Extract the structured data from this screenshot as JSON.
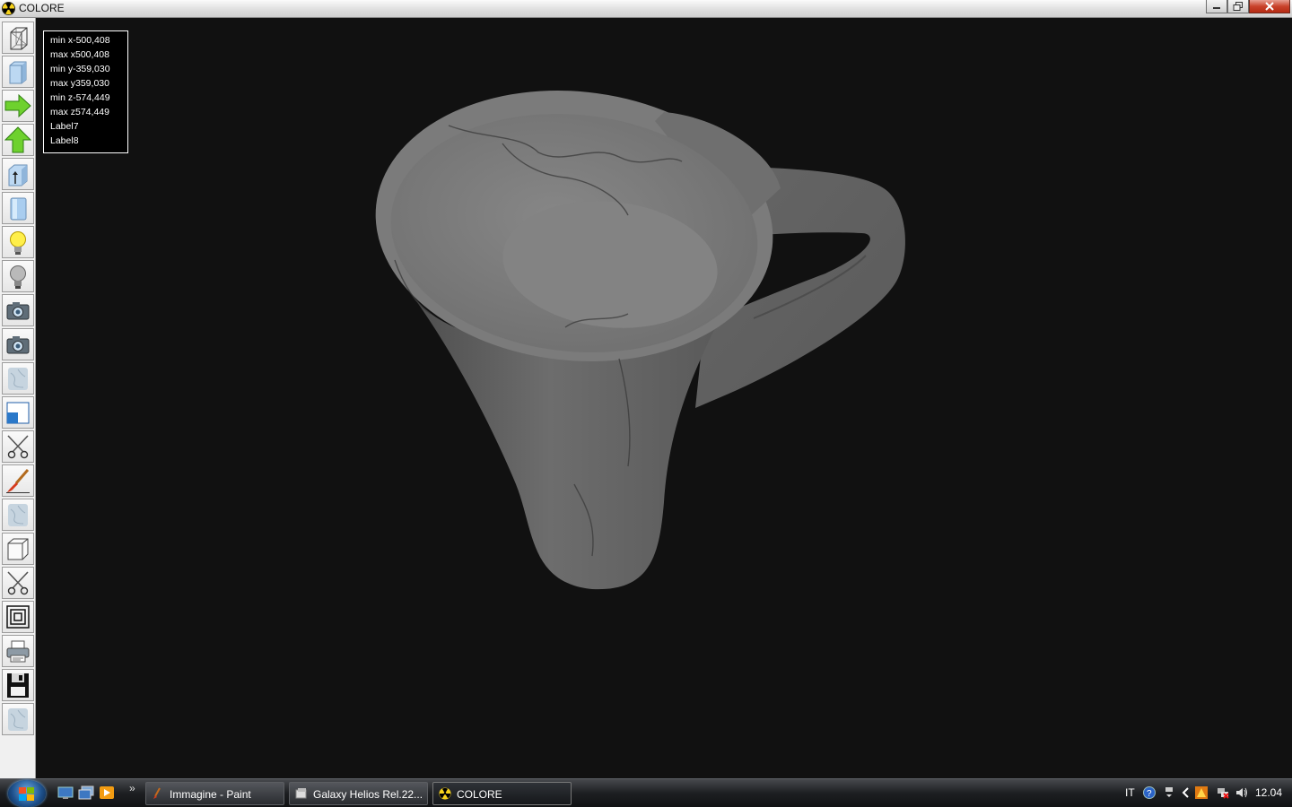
{
  "window": {
    "title": "COLORE",
    "controls": [
      "minimize",
      "restore",
      "close"
    ]
  },
  "toolbar": {
    "buttons": [
      {
        "name": "wireframe-box",
        "icon": "wireframe-box-icon"
      },
      {
        "name": "solid-box",
        "icon": "solid-box-icon"
      },
      {
        "name": "rotate-right",
        "icon": "green-arrow-right-icon"
      },
      {
        "name": "rotate-up",
        "icon": "green-arrow-up-icon"
      },
      {
        "name": "axis-box",
        "icon": "axis-box-icon"
      },
      {
        "name": "cylinder",
        "icon": "cylinder-icon"
      },
      {
        "name": "light-on",
        "icon": "bulb-on-icon"
      },
      {
        "name": "light-off",
        "icon": "bulb-off-icon"
      },
      {
        "name": "camera-1",
        "icon": "camera-icon"
      },
      {
        "name": "camera-2",
        "icon": "camera-icon"
      },
      {
        "name": "marble-texture-1",
        "icon": "marble-texture-icon"
      },
      {
        "name": "view-window",
        "icon": "window-icon"
      },
      {
        "name": "cut-1",
        "icon": "scissors-icon"
      },
      {
        "name": "paint-brush",
        "icon": "brush-icon"
      },
      {
        "name": "marble-texture-2",
        "icon": "marble-texture-icon"
      },
      {
        "name": "cube",
        "icon": "cube-icon"
      },
      {
        "name": "cut-2",
        "icon": "scissors-icon"
      },
      {
        "name": "concentric-squares",
        "icon": "concentric-squares-icon"
      },
      {
        "name": "print",
        "icon": "printer-icon"
      },
      {
        "name": "save",
        "icon": "floppy-disk-icon"
      },
      {
        "name": "marble-texture-3",
        "icon": "marble-texture-icon"
      }
    ]
  },
  "info_box": {
    "lines": [
      "min x-500,408",
      "max x500,408",
      "min y-359,030",
      "max y359,030",
      "min z-574,449",
      "max z574,449",
      "Label7",
      "Label8"
    ]
  },
  "viewport": {
    "background": "#111111",
    "model": "marble jug with handle",
    "model_color": "#6a6a6a"
  },
  "taskbar": {
    "tasks": [
      {
        "label": "Immagine - Paint",
        "icon": "paint-icon",
        "active": false
      },
      {
        "label": "Galaxy Helios  Rel.22...",
        "icon": "galaxy-helios-icon",
        "active": false
      },
      {
        "label": "COLORE",
        "icon": "radiation-icon",
        "active": true
      }
    ],
    "language": "IT",
    "clock": "12.04",
    "quick_launch": [
      "show-desktop-icon",
      "switch-windows-icon",
      "media-player-icon"
    ],
    "tray_icons": [
      "help-icon",
      "network-arrow-icon",
      "show-hidden-icon",
      "warning-icon",
      "network-icon",
      "volume-icon"
    ]
  }
}
